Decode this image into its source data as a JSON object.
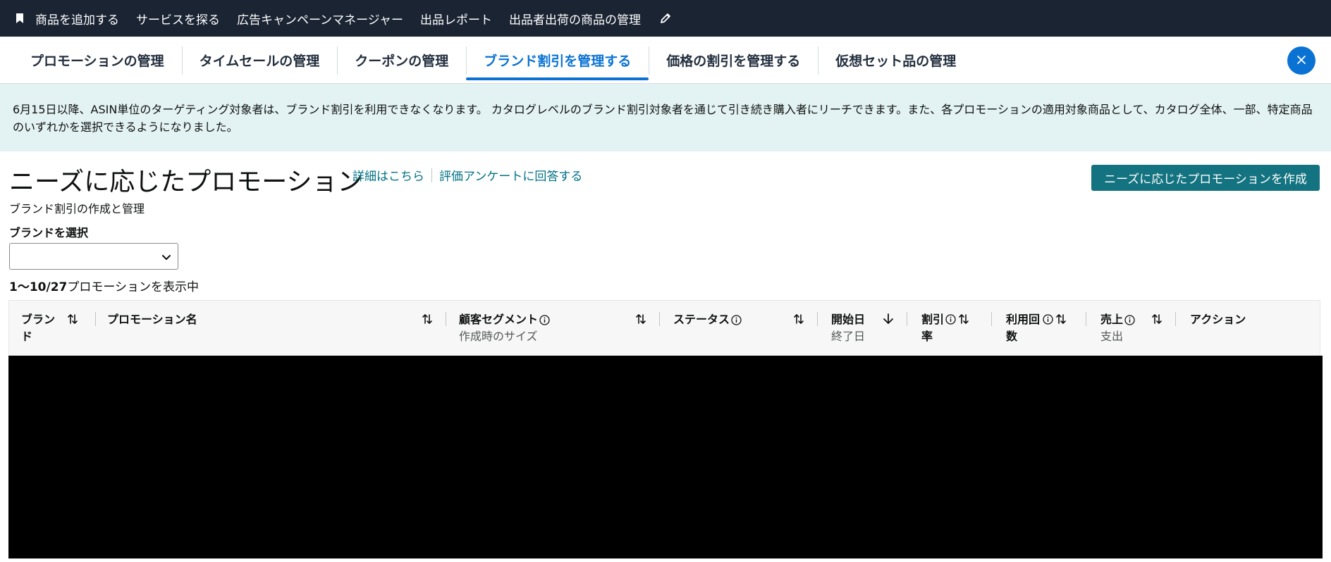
{
  "topnav": {
    "items": [
      "商品を追加する",
      "サービスを探る",
      "広告キャンペーンマネージャー",
      "出品レポート",
      "出品者出荷の商品の管理"
    ],
    "icons": {
      "bookmark": "bookmark-icon",
      "edit": "pencil-icon"
    }
  },
  "tabs": [
    {
      "label": "プロモーションの管理",
      "active": false
    },
    {
      "label": "タイムセールの管理",
      "active": false
    },
    {
      "label": "クーポンの管理",
      "active": false
    },
    {
      "label": "ブランド割引を管理する",
      "active": true
    },
    {
      "label": "価格の割引を管理する",
      "active": false
    },
    {
      "label": "仮想セット品の管理",
      "active": false
    }
  ],
  "notice": {
    "text": "6月15日以降、ASIN単位のターゲティング対象者は、ブランド割引を利用できなくなります。 カタログレベルのブランド割引対象者を通じて引き続き購入者にリーチできます。また、各プロモーションの適用対象商品として、カタログ全体、一部、特定商品のいずれかを選択できるようになりました。"
  },
  "header": {
    "title": "ニーズに応じたプロモーション",
    "link_learn_more": "詳細はこちら",
    "link_survey": "評価アンケートに回答する",
    "create_button": "ニーズに応じたプロモーションを作成",
    "subtitle": "ブランド割引の作成と管理"
  },
  "filter": {
    "brand_label": "ブランドを選択",
    "brand_value": ""
  },
  "results": {
    "range": "1〜10/27",
    "suffix": "プロモーションを表示中"
  },
  "table": {
    "columns": [
      {
        "label": "ブランド",
        "sub": "",
        "info": false,
        "sort": "both"
      },
      {
        "label": "プロモーション名",
        "sub": "",
        "info": false,
        "sort": "both"
      },
      {
        "label": "顧客セグメント",
        "sub": "作成時のサイズ",
        "info": true,
        "sort": "both"
      },
      {
        "label": "ステータス",
        "sub": "",
        "info": true,
        "sort": "both"
      },
      {
        "label": "開始日",
        "sub": "終了日",
        "info": false,
        "sort": "desc"
      },
      {
        "label": "割引率",
        "sub": "",
        "info": true,
        "sort": "both"
      },
      {
        "label": "利用回数",
        "sub": "",
        "info": true,
        "sort": "both"
      },
      {
        "label": "売上",
        "sub": "支出",
        "info": true,
        "sort": "both"
      },
      {
        "label": "アクション",
        "sub": "",
        "info": false,
        "sort": "none"
      }
    ]
  },
  "colors": {
    "topbar": "#1b2433",
    "accent_blue": "#0972d3",
    "notice_bg": "#e3f2f2",
    "teal_button": "#147380",
    "link": "#007185"
  }
}
